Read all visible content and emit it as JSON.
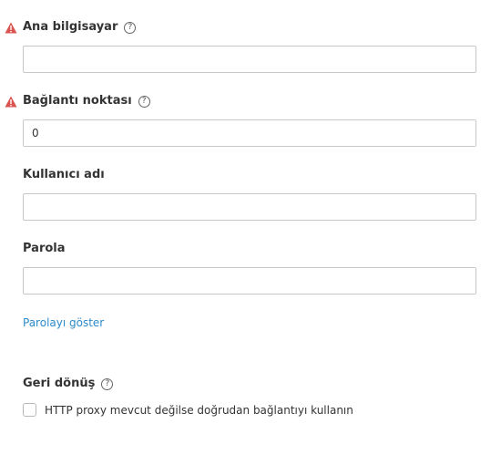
{
  "host": {
    "label": "Ana bilgisayar",
    "value": "",
    "required_warning": true
  },
  "port": {
    "label": "Bağlantı noktası",
    "value": "0",
    "required_warning": true
  },
  "username": {
    "label": "Kullanıcı adı",
    "value": ""
  },
  "password": {
    "label": "Parola",
    "value": ""
  },
  "show_password_link": "Parolayı göster",
  "fallback": {
    "label": "Geri dönüş",
    "checkbox_label": "HTTP proxy mevcut değilse doğrudan bağlantıyı kullanın",
    "checked": false
  },
  "icons": {
    "warning": "warning-triangle-icon",
    "help": "help-circle-icon"
  },
  "colors": {
    "warning": "#d9534f",
    "link": "#2b8ac8"
  }
}
